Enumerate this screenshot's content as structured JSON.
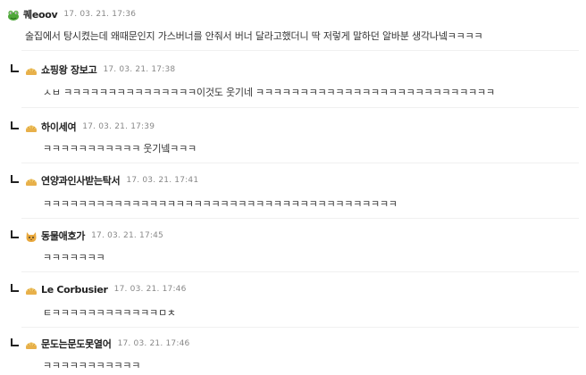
{
  "comments": [
    {
      "nick": "퀘eoov",
      "date": "17. 03. 21.  17:36",
      "text": "술집에서 탕시켰는데 왜때문인지 가스버너를 안줘서 버너 달라고했더니 딱 저렇게 말하던 알바분 생각나넼ㅋㅋㅋㅋ",
      "avatar": "frog-avatar-icon"
    },
    {
      "nick": "쇼핑왕 장보고",
      "date": "17. 03. 21.  17:38",
      "text": "ㅅㅂ ㅋㅋㅋㅋㅋㅋㅋㅋㅋㅋㅋㅋㅋㅋㅋ이것도 웃기네 ㅋㅋㅋㅋㅋㅋㅋㅋㅋㅋㅋㅋㅋㅋㅋㅋㅋㅋㅋㅋㅋㅋㅋㅋㅋㅋㅋ",
      "avatar": "pie-avatar-icon"
    },
    {
      "nick": "하이세여",
      "date": "17. 03. 21.  17:39",
      "text": "ㅋㅋㅋㅋㅋㅋㅋㅋㅋㅋㅋ 웃기넼ㅋㅋㅋ",
      "avatar": "pie-avatar-icon"
    },
    {
      "nick": "연양과인사받는탁서",
      "date": "17. 03. 21.  17:41",
      "text": "ㅋㅋㅋㅋㅋㅋㅋㅋㅋㅋㅋㅋㅋㅋㅋㅋㅋㅋㅋㅋㅋㅋㅋㅋㅋㅋㅋㅋㅋㅋㅋㅋㅋㅋㅋㅋㅋㅋㅋㅋ",
      "avatar": "pie-avatar-icon"
    },
    {
      "nick": "동물애호가",
      "date": "17. 03. 21.  17:45",
      "text": "ㅋㅋㅋㅋㅋㅋㅋ",
      "avatar": "cat-avatar-icon"
    },
    {
      "nick": "Le Corbusier",
      "date": "17. 03. 21.  17:46",
      "text": "ㅌㅋㅋㅋㅋㅋㅋㅋㅋㅋㅋㅋㅋㅁㅊ",
      "avatar": "pie-avatar-icon"
    },
    {
      "nick": "문도는문도못열어",
      "date": "17. 03. 21.  17:46",
      "text": "ㅋㅋㅋㅋㅋㅋㅋㅋㅋㅋㅋ",
      "avatar": "pie-avatar-icon"
    }
  ],
  "colors": {
    "nick": "#222222",
    "date": "#888888",
    "text": "#333333",
    "pie": "#e8b04a",
    "frog": "#3a8a2c"
  }
}
